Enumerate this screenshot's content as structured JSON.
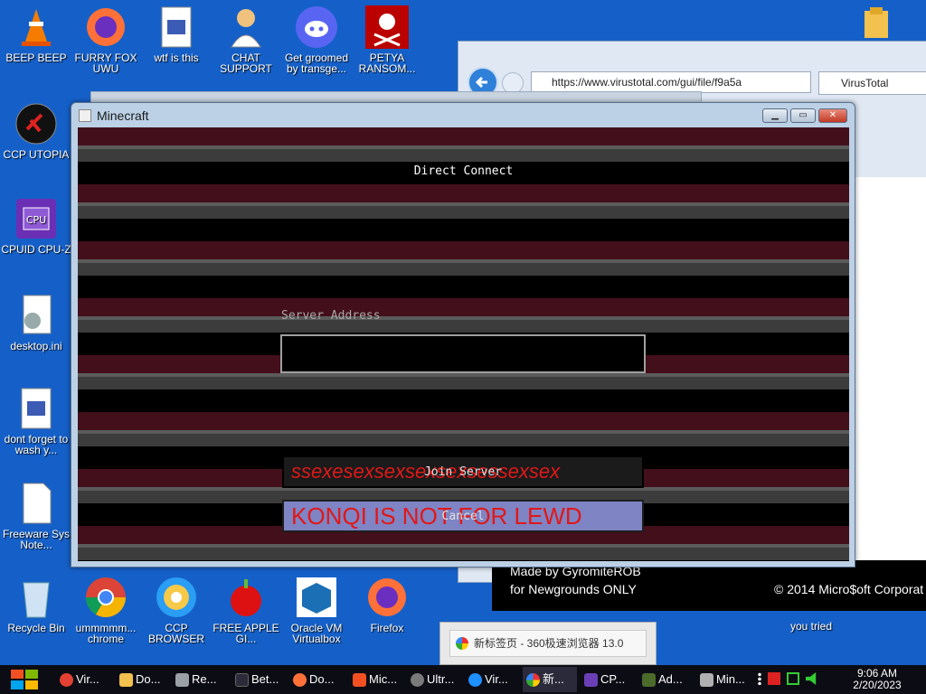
{
  "desktop": {
    "icons": [
      {
        "label": "BEEP BEEP"
      },
      {
        "label": "FURRY FOX UWU"
      },
      {
        "label": "wtf is this"
      },
      {
        "label": "CHAT SUPPORT"
      },
      {
        "label": "Get groomed by transge..."
      },
      {
        "label": "PETYA RANSOM..."
      },
      {
        "label": "CCP UTOPIA"
      },
      {
        "label": "CPUID CPU-Z"
      },
      {
        "label": "desktop.ini"
      },
      {
        "label": "dont forget to wash y..."
      },
      {
        "label": "Freeware Sys Note..."
      },
      {
        "label": "Recycle Bin"
      },
      {
        "label": "ummmmm... chrome"
      },
      {
        "label": "CCP BROWSER"
      },
      {
        "label": "FREE APPLE GI..."
      },
      {
        "label": "Oracle VM Virtualbox"
      },
      {
        "label": "Firefox"
      },
      {
        "label": "you tried"
      }
    ]
  },
  "background_browser": {
    "url": "https://www.virustotal.com/gui/file/f9a5a",
    "tab_title": "VirusTotal"
  },
  "ad_banner": {
    "line1": "Made by GyromiteROB",
    "line2": "for Newgrounds ONLY",
    "copyright": "© 2014 Micro$oft Corporat"
  },
  "minecraft": {
    "window_title": "Minecraft",
    "heading": "Direct Connect",
    "server_address_label": "Server Address",
    "server_address_value": "",
    "join_label": "Join Server",
    "join_overlay": "ssexesexsexsexsexsessexsex",
    "cancel_label": "Cancel",
    "cancel_overlay": "KONQI IS NOT FOR LEWD"
  },
  "tooltip": {
    "text": "新标签页 - 360极速浏览器 13.0"
  },
  "taskbar": {
    "items": [
      {
        "label": "Vir...",
        "color": "#e34133"
      },
      {
        "label": "Do...",
        "color": "#f2c14e"
      },
      {
        "label": "Re...",
        "color": "#9aa0a6"
      },
      {
        "label": "Bet...",
        "color": "#2b2b3a"
      },
      {
        "label": "Do...",
        "color": "#ff7139"
      },
      {
        "label": "Mic...",
        "color": "#f25022"
      },
      {
        "label": "Ultr...",
        "color": "#7a7a7a"
      },
      {
        "label": "Vir...",
        "color": "#1e90ff"
      },
      {
        "label": "新...",
        "color": "#3aa757"
      },
      {
        "label": "CP...",
        "color": "#6a3fb5"
      },
      {
        "label": "Ad...",
        "color": "#4a6b2a"
      },
      {
        "label": "Min...",
        "color": "#b0b0b0"
      }
    ],
    "time": "9:06 AM",
    "date": "2/20/2023"
  },
  "colors": {
    "desktop": "#1560c8",
    "mc_stripe_red": "#430f1a",
    "mc_overlay_text": "#e01818"
  }
}
